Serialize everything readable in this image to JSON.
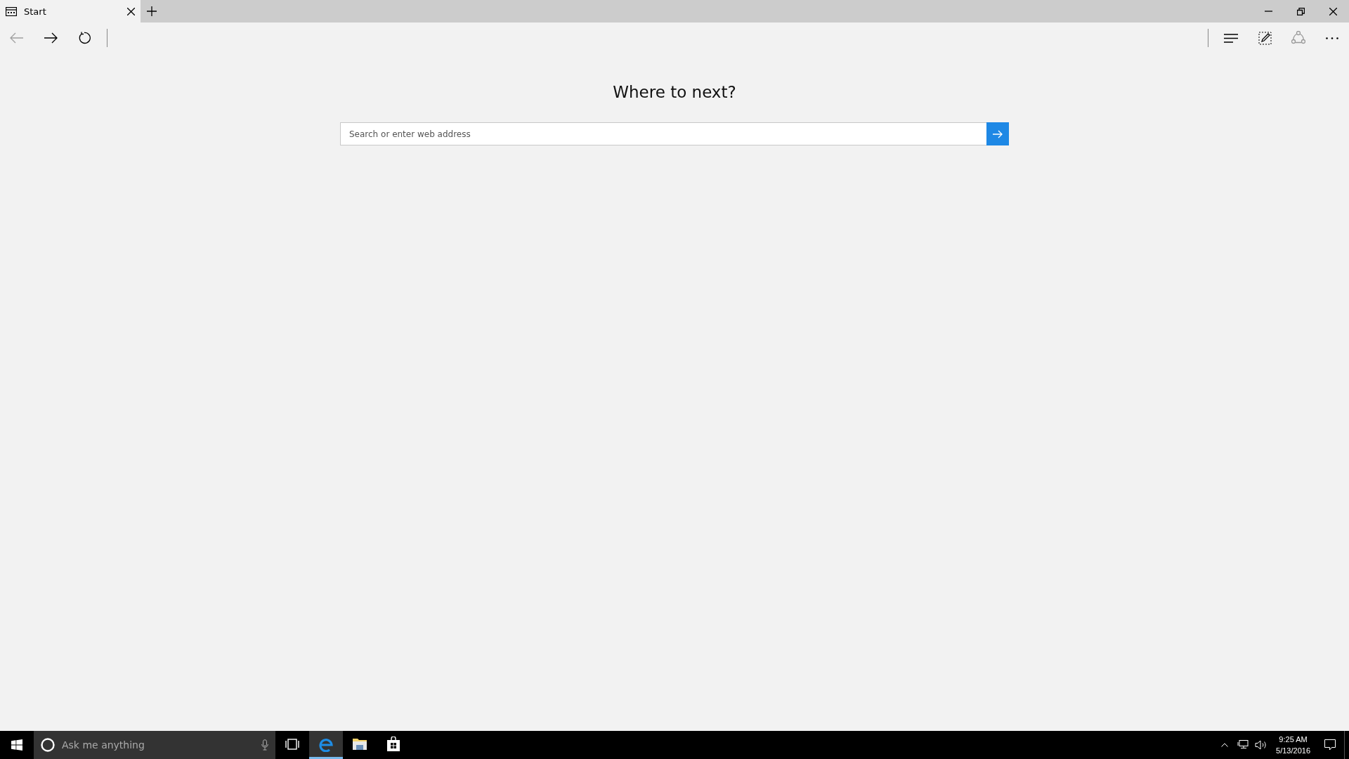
{
  "tabs": [
    {
      "title": "Start",
      "selected": true
    }
  ],
  "toolbar": {
    "back": {
      "disabled": true
    },
    "forward": {
      "disabled": false
    }
  },
  "start_page": {
    "heading": "Where to next?",
    "search": {
      "placeholder": "Search or enter web address"
    }
  },
  "taskbar": {
    "search": {
      "placeholder": "Ask me anything"
    },
    "apps": [
      {
        "kind": "task-view",
        "selected": false
      },
      {
        "kind": "browser",
        "selected": true
      },
      {
        "kind": "files",
        "selected": false
      },
      {
        "kind": "store",
        "selected": false
      }
    ],
    "clock": {
      "time": "9:25 AM",
      "date": "5/13/2016"
    }
  }
}
